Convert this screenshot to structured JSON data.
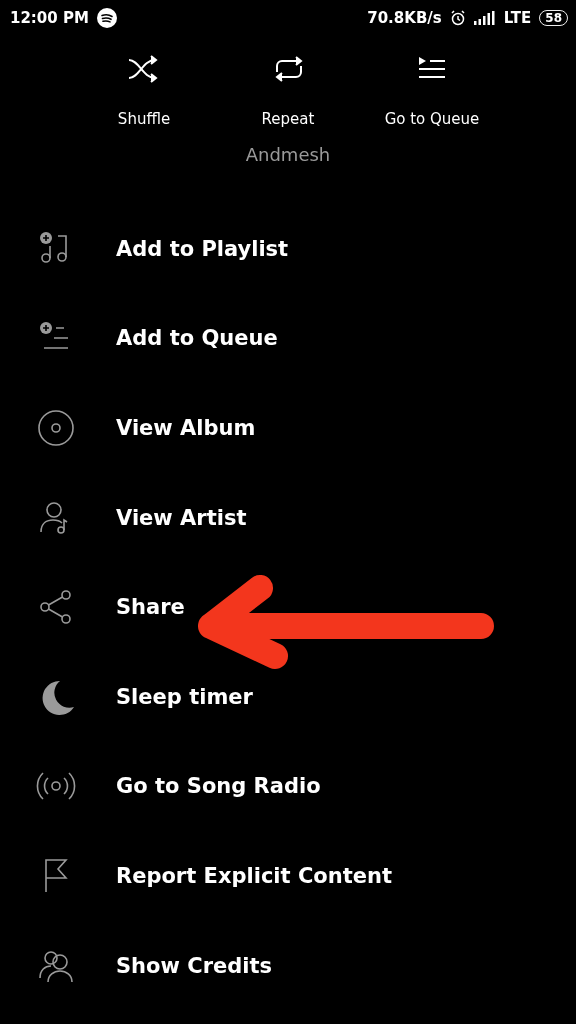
{
  "status_bar": {
    "time": "12:00 PM",
    "speed": "70.8KB/s",
    "network": "LTE",
    "battery": "58"
  },
  "actions": [
    {
      "label": "Shuffle"
    },
    {
      "label": "Repeat"
    },
    {
      "label": "Go to Queue"
    }
  ],
  "artist": "Andmesh",
  "menu": [
    {
      "label": "Add to Playlist"
    },
    {
      "label": "Add to Queue"
    },
    {
      "label": "View Album"
    },
    {
      "label": "View Artist"
    },
    {
      "label": "Share"
    },
    {
      "label": "Sleep timer"
    },
    {
      "label": "Go to Song Radio"
    },
    {
      "label": "Report Explicit Content"
    },
    {
      "label": "Show Credits"
    }
  ],
  "annotation": {
    "kind": "arrow"
  }
}
